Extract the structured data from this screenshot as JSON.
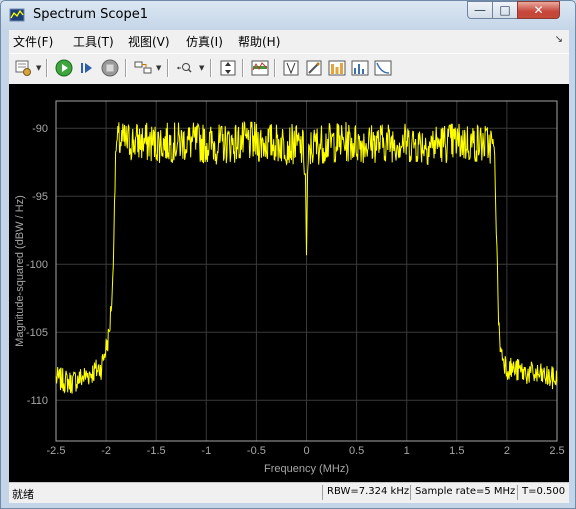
{
  "window": {
    "title": "Spectrum Scope1",
    "minimize_glyph": "—",
    "maximize_glyph": "□",
    "close_glyph": "✕"
  },
  "menu": {
    "items": [
      "文件(F)",
      "工具(T)",
      "视图(V)",
      "仿真(I)",
      "帮助(H)"
    ],
    "pin_glyph": "↘"
  },
  "toolbar": {
    "icons": [
      "print-settings-icon",
      "run-icon",
      "step-forward-icon",
      "stop-icon",
      "signal-select-icon",
      "zoom-icon",
      "autoscale-icon",
      "spectrum-settings-icon",
      "data-cursors-icon",
      "measurement-icon",
      "peak-finder-icon",
      "distortion-icon",
      "ccdf-icon"
    ]
  },
  "status": {
    "left_text": "就绪",
    "rbw": "RBW=7.324 kHz",
    "sample_rate": "Sample rate=5 MHz",
    "time": "T=0.500"
  },
  "colors": {
    "trace": "#ffff00",
    "axes_text": "#a6a6a6",
    "grid": "#3a3a3a",
    "background": "#000000"
  },
  "chart_data": {
    "type": "line",
    "xlabel": "Frequency (MHz)",
    "ylabel": "Magnitude-squared (dBW / Hz)",
    "xlim": [
      -2.5,
      2.5
    ],
    "ylim": [
      -113,
      -88
    ],
    "xticks": [
      "-2.5",
      "-2",
      "-1.5",
      "-1",
      "-0.5",
      "0",
      "0.5",
      "1",
      "1.5",
      "2",
      "2.5"
    ],
    "xtick_values": [
      -2.5,
      -2,
      -1.5,
      -1,
      -0.5,
      0,
      0.5,
      1,
      1.5,
      2,
      2.5
    ],
    "yticks": [
      "-90",
      "-95",
      "-100",
      "-105",
      "-110"
    ],
    "ytick_values": [
      -90,
      -95,
      -100,
      -105,
      -110
    ],
    "grid": true,
    "series": [
      {
        "color": "#ffff00",
        "x": [
          -2.5,
          -2.35,
          -2.2,
          -2.05,
          -1.97,
          -1.93,
          -1.92,
          -1.9,
          -1.88,
          -1.7,
          -1.5,
          -1.2,
          -0.9,
          -0.6,
          -0.3,
          -0.1,
          -0.03,
          -0.01,
          0.0,
          0.01,
          0.03,
          0.1,
          0.3,
          0.6,
          0.9,
          1.2,
          1.5,
          1.7,
          1.86,
          1.88,
          1.9,
          1.92,
          1.94,
          2.0,
          2.2,
          2.35,
          2.5
        ],
        "y": [
          -108.4,
          -108.7,
          -108.2,
          -107.6,
          -105.2,
          -101,
          -96,
          -91.3,
          -91.0,
          -91.0,
          -91.1,
          -91.0,
          -91.2,
          -91.0,
          -91.1,
          -91.2,
          -91.6,
          -93.5,
          -99.3,
          -93.5,
          -91.6,
          -91.2,
          -91.0,
          -91.1,
          -91.0,
          -91.2,
          -91.0,
          -91.1,
          -91.2,
          -92.5,
          -99,
          -104.8,
          -106.4,
          -107.6,
          -108.0,
          -108.2,
          -108.5
        ]
      }
    ]
  }
}
